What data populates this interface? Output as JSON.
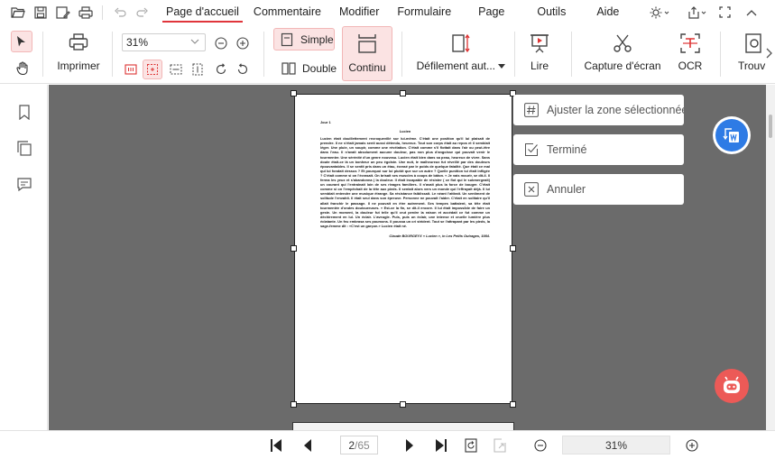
{
  "menubar": {
    "items": [
      "Page d'accueil",
      "Commentaire",
      "Modifier",
      "Formulaire",
      "Page",
      "Outils",
      "Aide"
    ],
    "active_index": 0,
    "accent": "#e0353b"
  },
  "ribbon": {
    "print_label": "Imprimer",
    "zoom_value": "31%",
    "single_label": "Simple",
    "double_label": "Double",
    "continuous_label": "Continu",
    "scroll_label": "Défilement aut...",
    "read_label": "Lire",
    "capture_label": "Capture d'écran",
    "ocr_label": "OCR",
    "find_label": "Trouv"
  },
  "panel": {
    "fit_label": "Ajuster la zone sélectionnée.",
    "done_label": "Terminé",
    "cancel_label": "Annuler"
  },
  "document": {
    "day": "Jour 1",
    "title": "Lucien",
    "body": "Lucien était douillettement recroquevillé sur lui-même. C'était une position qu'il lui plaisait de prendre. Il ne s'était jamais senti aussi détendu, heureux. Tout son corps était au repos et il semblait léger. Une pluie, un soupir, comme une révélation. C'était comme s'il flottait dans l'air ou peut-être dans l'eau. Il n'avait absolument aucune douleur, pas non plus d'angoisse qui pouvait venir le tourmenter. Une sérénité d'un genre nouveau. Lucien était bien dans sa peau, heureux de vivre. Sans doute était-ce là un bonheur un peu égoïste. Une nuit, le malheureux fut réveillé par des douleurs épouvantables. Il se sentit pris dans un étau, écrasé par le poids de quelque fatalité. Que était ce mal qui lui fondait dessus ? Et pourquoi sur lui plutôt que sur un autre ? Quelle punition lui était infligée ? C'était comme si on l'écrasait. On brisait ses muscles à coups de bâton. « Je vais mourir, se dit-il. Il ferma les yeux et s'abandonna ( la douleur. Il était incapable de résister ( ce flot qui le submergeait) un courant qui l'entraînait loin de ses rivages familiers. Il n'avait plus la force de bouger. C'était comme si on l'empêchait de la tête aux pieds. Il sentait alors vers un monde qui l'effrayait déjà. Il lui semblait entendre une musique étrange. Sa résistance faiblissait. Le néant l'attirait. Un sentiment de solitude l'envahit. Il était seul dans son épreuve. Personne ne pouvait l'aider. C'était en solitaire qu'il allait franchir le passage. Il ne pouvait en être autrement. Ses tempes battaient, sa tête était tourmentée d'ondes douloureuses. « Est-ce la fin, se dit-il encore. Il lui était impossible de faire un geste. Un moment, la douleur fut telle qu'il crut perdre la raison et accédait ce fut comme un déchirement en lui. Un éclair. L'aveugle. Puis, puis un éclair, une intense et cruelle lumière plus éclatante. Un feu embrasa ses poumons. Il poussa un cri strident. Tout se l'attrapant par les pieds, la sage-femme dit : «C'est un garçon.» Lucien était né.",
    "citation": "Claude BOURGEYX « Lucien », in Les Petits Outrages, 1984."
  },
  "bottom": {
    "current_page": "2",
    "total_pages": "/65",
    "zoom_value": "31%"
  },
  "colors": {
    "accent": "#e0353b",
    "selected_bg": "#fbe3e3",
    "word_blue": "#2e7be5",
    "ai_red": "#ec5a57",
    "canvas": "#6b6b6b"
  }
}
